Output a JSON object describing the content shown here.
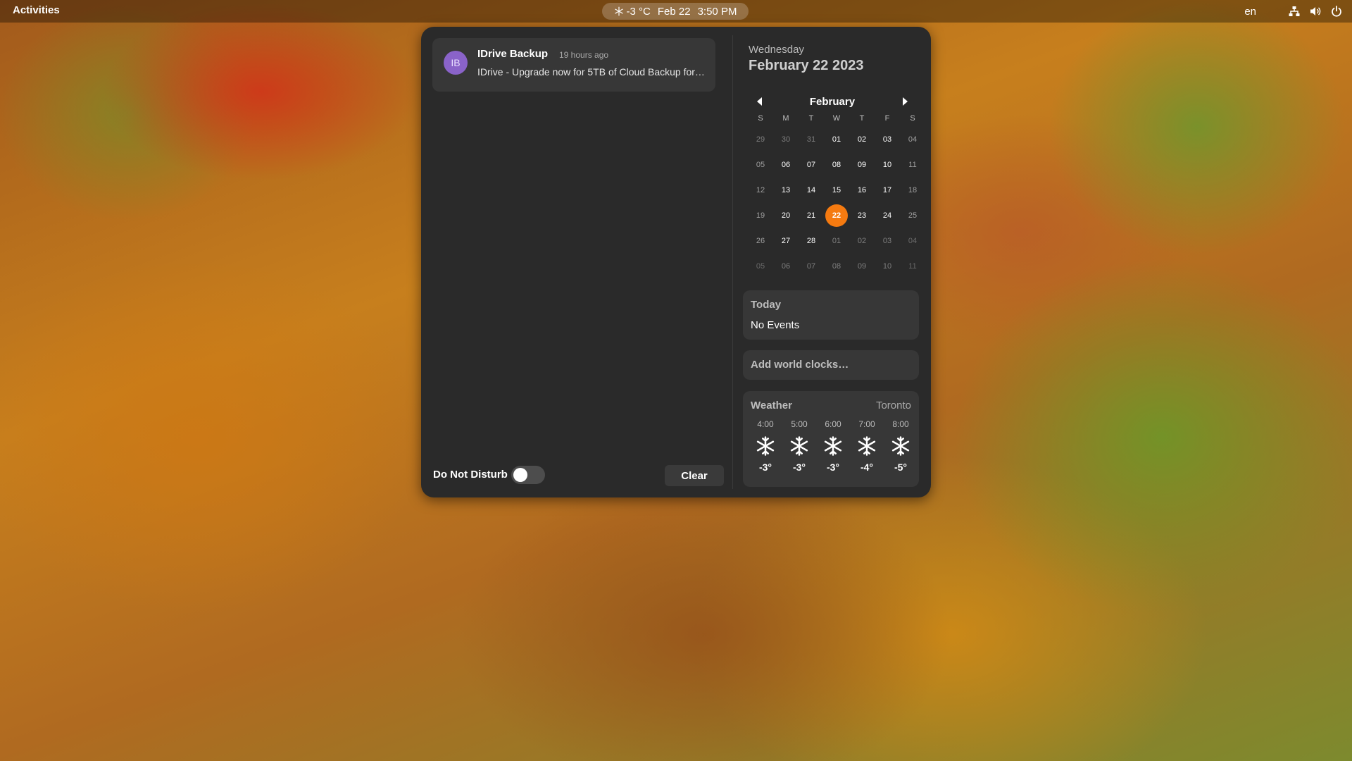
{
  "topbar": {
    "activities": "Activities",
    "weather_temp": "-3 °C",
    "date": "Feb 22",
    "time": "3:50 PM",
    "language": "en"
  },
  "notifications": {
    "items": [
      {
        "avatar_initials": "IB",
        "app": "IDrive Backup",
        "time": "19 hours ago",
        "body": "IDrive - Upgrade now for 5TB of Cloud Backup for…"
      }
    ],
    "dnd_label": "Do Not Disturb",
    "dnd_enabled": false,
    "clear_label": "Clear"
  },
  "calendar": {
    "weekday": "Wednesday",
    "full_date": "February 22 2023",
    "month": "February",
    "day_headers": [
      "S",
      "M",
      "T",
      "W",
      "T",
      "F",
      "S"
    ],
    "weeks": [
      [
        "29",
        "30",
        "31",
        "01",
        "02",
        "03",
        "04"
      ],
      [
        "05",
        "06",
        "07",
        "08",
        "09",
        "10",
        "11"
      ],
      [
        "12",
        "13",
        "14",
        "15",
        "16",
        "17",
        "18"
      ],
      [
        "19",
        "20",
        "21",
        "22",
        "23",
        "24",
        "25"
      ],
      [
        "26",
        "27",
        "28",
        "01",
        "02",
        "03",
        "04"
      ],
      [
        "05",
        "06",
        "07",
        "08",
        "09",
        "10",
        "11"
      ]
    ],
    "selected_day": "22",
    "accent_color": "#f57a10"
  },
  "events": {
    "title": "Today",
    "status": "No Events"
  },
  "world_clocks": {
    "label": "Add world clocks…"
  },
  "weather": {
    "title": "Weather",
    "location": "Toronto",
    "forecast": [
      {
        "hour": "4:00",
        "icon": "snowflake-icon",
        "temp": "-3°"
      },
      {
        "hour": "5:00",
        "icon": "snowflake-icon",
        "temp": "-3°"
      },
      {
        "hour": "6:00",
        "icon": "snowflake-icon",
        "temp": "-3°"
      },
      {
        "hour": "7:00",
        "icon": "snowflake-icon",
        "temp": "-4°"
      },
      {
        "hour": "8:00",
        "icon": "snowflake-icon",
        "temp": "-5°"
      }
    ]
  }
}
